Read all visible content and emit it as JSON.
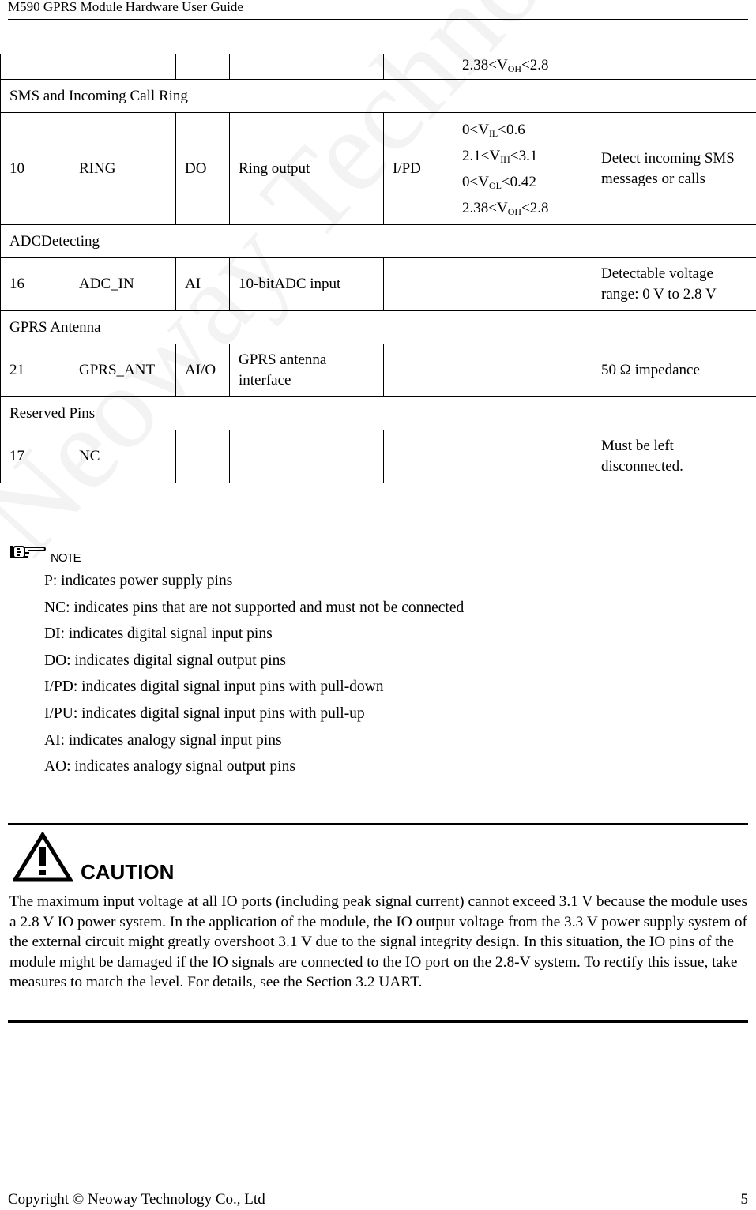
{
  "header": {
    "title": "M590 GPRS Module Hardware User Guide"
  },
  "watermark": "Neoway Technology",
  "pin_table": {
    "rows": [
      {
        "type": "data",
        "cells": [
          "",
          "",
          "",
          "",
          "",
          "",
          ""
        ],
        "levels": [
          "2.38<V|OH|<2.8"
        ]
      },
      {
        "type": "section",
        "label": "SMS and Incoming Call Ring"
      },
      {
        "type": "data",
        "pin": "10",
        "name": "RING",
        "io": "DO",
        "function": "Ring output",
        "reset": "I/PD",
        "levels": [
          {
            "pre": "0<V",
            "sub": "IL",
            "post": "<0.6"
          },
          {
            "pre": "2.1<V",
            "sub": "IH",
            "post": "<3.1"
          },
          {
            "pre": "0<V",
            "sub": "OL",
            "post": "<0.42"
          },
          {
            "pre": "2.38<V",
            "sub": "OH",
            "post": "<2.8"
          }
        ],
        "remark": "Detect incoming SMS messages or calls"
      },
      {
        "type": "section",
        "label": "ADCDetecting"
      },
      {
        "type": "data",
        "pin": "16",
        "name": "ADC_IN",
        "io": "AI",
        "function": "10-bitADC input",
        "reset": "",
        "remark": "Detectable voltage range: 0 V to 2.8 V"
      },
      {
        "type": "section",
        "label": "GPRS Antenna"
      },
      {
        "type": "data",
        "pin": "21",
        "name": "GPRS_ANT",
        "io": "AI/O",
        "function": "GPRS antenna interface",
        "reset": "",
        "remark": "50 Ω impedance"
      },
      {
        "type": "section",
        "label": "Reserved Pins"
      },
      {
        "type": "data",
        "pin": "17",
        "name": "NC",
        "io": "",
        "function": "",
        "reset": "",
        "remark": "Must be left disconnected."
      }
    ],
    "top_row_level": {
      "pre": "2.38<V",
      "sub": "OH",
      "post": "<2.8"
    }
  },
  "note": {
    "label": "NOTE",
    "icon": "pointing-hand-icon",
    "items": [
      "P: indicates power supply pins",
      "NC: indicates pins that are not supported and must not be connected",
      "DI: indicates digital signal input pins",
      "DO: indicates digital signal output pins",
      "I/PD: indicates digital signal input pins with pull-down",
      "I/PU: indicates digital signal input pins with pull-up",
      "AI: indicates analogy signal input pins",
      "AO: indicates analogy signal output pins"
    ]
  },
  "caution": {
    "label": "CAUTION",
    "icon": "warning-triangle-icon",
    "body": "The maximum input voltage at all IO ports (including peak signal current) cannot exceed 3.1 V because the module uses a 2.8 V IO power system. In the application of the module, the IO output voltage from the 3.3 V power supply system of the external circuit might greatly overshoot 3.1 V due to the signal integrity design. In this situation, the IO pins of the module might be damaged if the IO signals are connected to the IO port on the 2.8-V system. To rectify this issue, take measures to match the level. For details, see the Section 3.2 UART."
  },
  "footer": {
    "copyright": "Copyright © Neoway Technology Co., Ltd",
    "page_number": "5"
  }
}
